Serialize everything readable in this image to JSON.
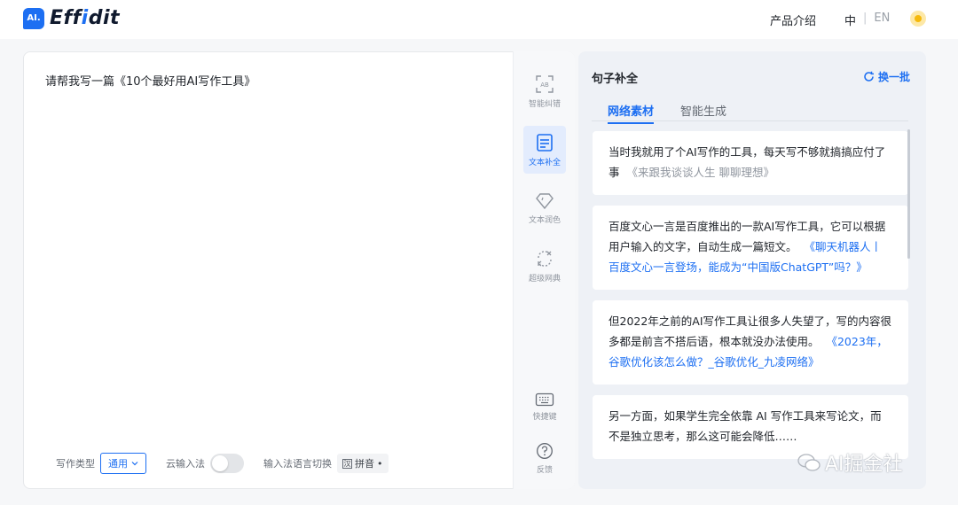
{
  "header": {
    "logo_badge": "AI.",
    "logo_text_part1": "Eff",
    "logo_text_accent": "i",
    "logo_text_part2": "dit",
    "nav_product": "产品介绍",
    "lang_zh": "中",
    "lang_sep": "|",
    "lang_en": "EN"
  },
  "editor": {
    "content": "请帮我写一篇《10个最好用AI写作工具》",
    "footer": {
      "type_label": "写作类型",
      "type_value": "通用",
      "cloud_input_label": "云输入法",
      "lang_switch_label": "输入法语言切换",
      "pinyin_box": "汉",
      "pinyin_label": "拼音"
    }
  },
  "rail": {
    "tools": [
      {
        "label": "智能纠错",
        "icon": "ab-correct-icon"
      },
      {
        "label": "文本补全",
        "icon": "document-icon",
        "active": true
      },
      {
        "label": "文本润色",
        "icon": "diamond-icon"
      },
      {
        "label": "超级网典",
        "icon": "translate-icon"
      },
      {
        "label": "快捷键",
        "icon": "keyboard-icon"
      },
      {
        "label": "反馈",
        "icon": "question-icon"
      }
    ]
  },
  "side": {
    "title": "句子补全",
    "refresh_label": "换一批",
    "tabs": [
      {
        "label": "网络素材",
        "active": true
      },
      {
        "label": "智能生成",
        "active": false
      }
    ],
    "cards": [
      {
        "text": "当时我就用了个AI写作的工具，每天写不够就搞搞应付了事",
        "source": "《来跟我谈谈人生 聊聊理想》",
        "source_link": false
      },
      {
        "text": "百度文心一言是百度推出的一款AI写作工具，它可以根据用户输入的文字，自动生成一篇短文。",
        "source": "《聊天机器人丨百度文心一言登场，能成为“中国版ChatGPT”吗？》",
        "source_link": true
      },
      {
        "text": "但2022年之前的AI写作工具让很多人失望了，写的内容很多都是前言不搭后语，根本就没办法使用。",
        "source": "《2023年，谷歌优化该怎么做？_谷歌优化_九凌网络》",
        "source_link": true
      },
      {
        "text": "另一方面，如果学生完全依靠 AI 写作工具来写论文，而不是独立思考，那么这可能会降低……",
        "source": "",
        "source_link": false
      }
    ]
  },
  "watermark": {
    "text": "AI掘金社"
  },
  "colors": {
    "accent": "#1d6ff2",
    "panel_bg": "#eef1f6",
    "page_bg": "#f6f7f9"
  }
}
